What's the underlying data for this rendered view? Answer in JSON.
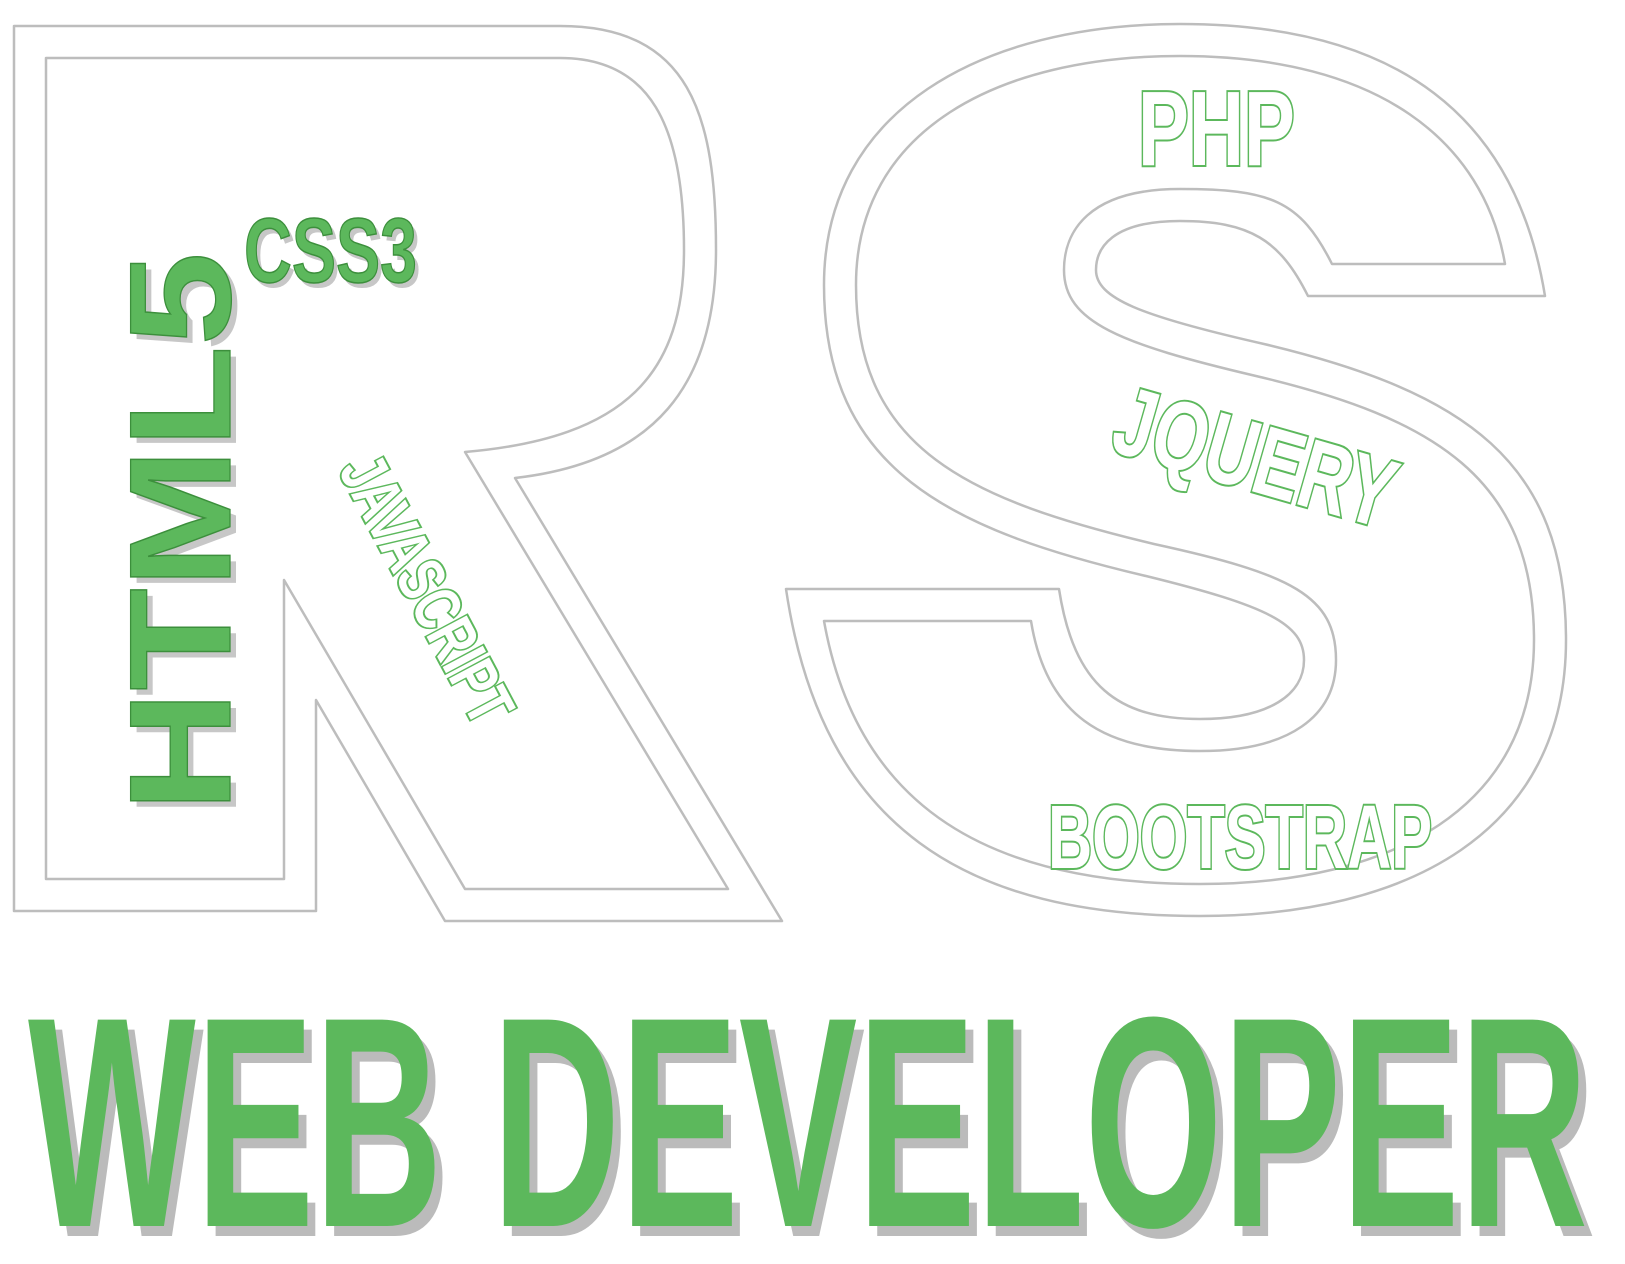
{
  "logo": {
    "monogram": "RS",
    "tagline": "WEB DEVELOPER"
  },
  "skills": {
    "css": "CSS3",
    "html": "HTML5",
    "javascript": "JAVASCRIPT",
    "php": "PHP",
    "jquery": "JQUERY",
    "bootstrap": "BOOTSTRAP"
  },
  "colors": {
    "accent": "#5cb85c",
    "outline": "#ffffff",
    "shadow": "#8a8a8a"
  }
}
